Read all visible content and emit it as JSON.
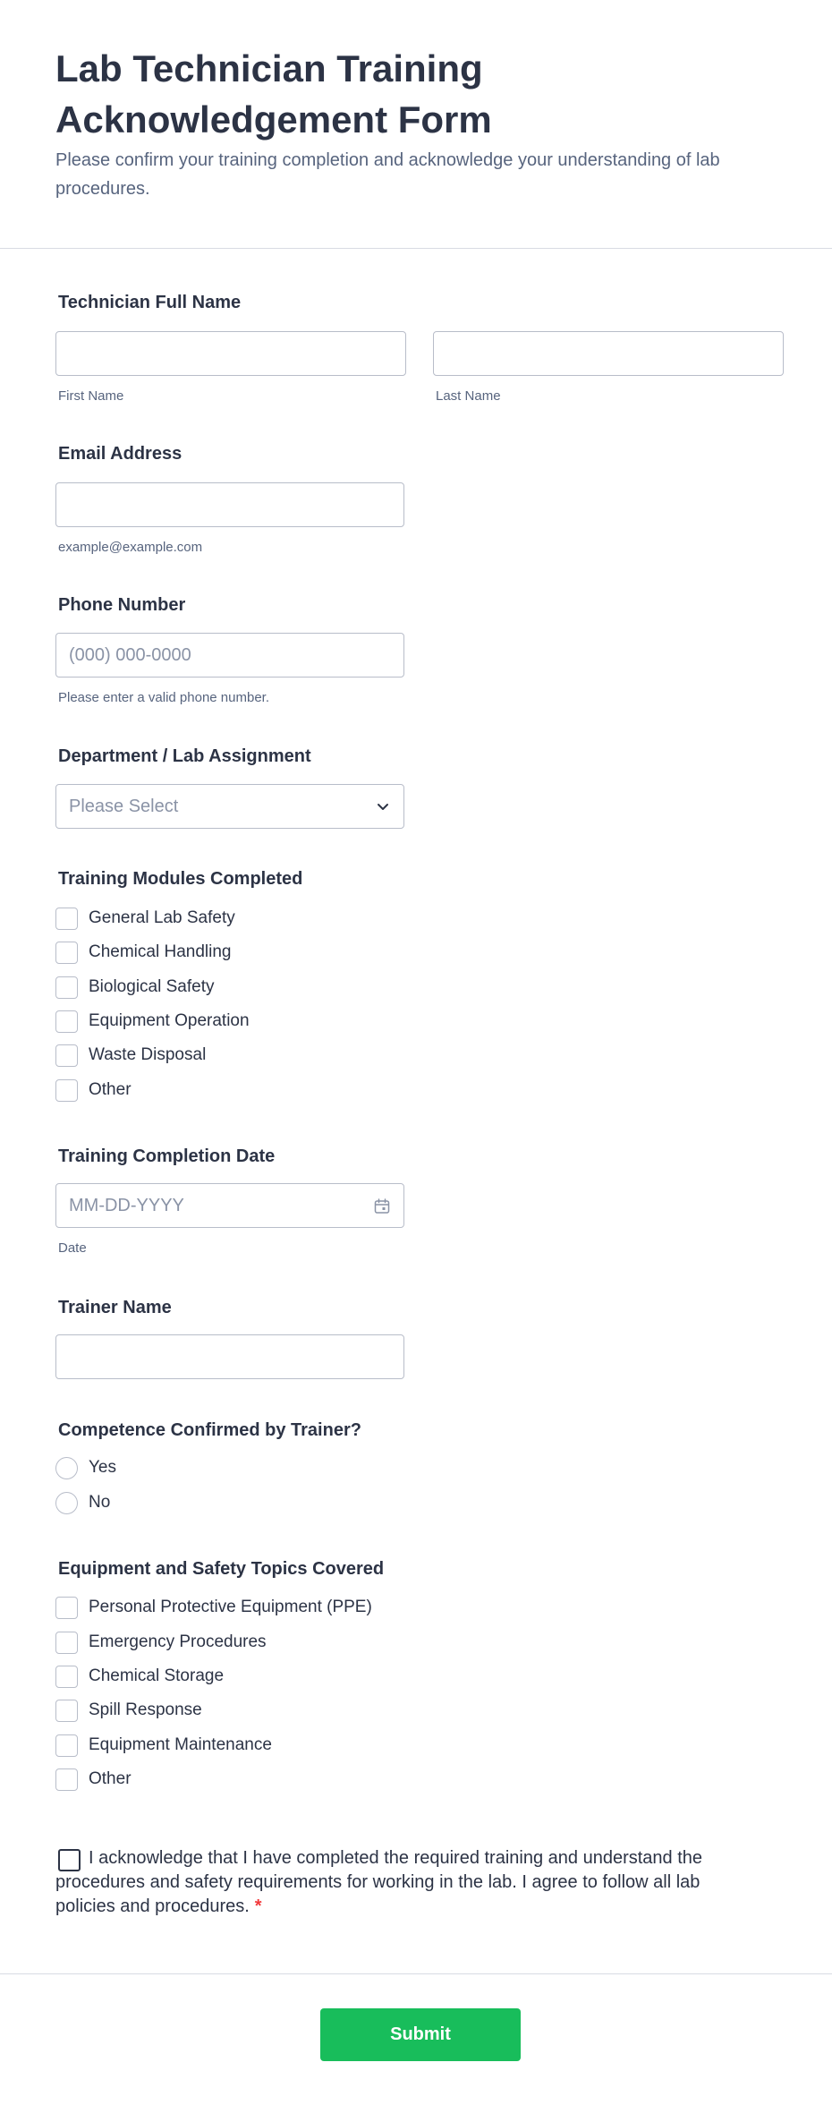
{
  "form": {
    "title": "Lab Technician Training Acknowledgement Form",
    "subtitle": "Please confirm your training completion and acknowledge your understanding of lab procedures."
  },
  "full_name": {
    "label": "Technician Full Name",
    "first_sublabel": "First Name",
    "last_sublabel": "Last Name"
  },
  "email": {
    "label": "Email Address",
    "sublabel": "example@example.com"
  },
  "phone": {
    "label": "Phone Number",
    "placeholder": "(000) 000-0000",
    "sublabel": "Please enter a valid phone number."
  },
  "department": {
    "label": "Department / Lab Assignment",
    "placeholder": "Please Select"
  },
  "modules": {
    "label": "Training Modules Completed",
    "options": [
      "General Lab Safety",
      "Chemical Handling",
      "Biological Safety",
      "Equipment Operation",
      "Waste Disposal",
      "Other"
    ]
  },
  "completion_date": {
    "label": "Training Completion Date",
    "placeholder": "MM-DD-YYYY",
    "sublabel": "Date"
  },
  "trainer": {
    "label": "Trainer Name"
  },
  "competence": {
    "label": "Competence Confirmed by Trainer?",
    "options": [
      "Yes",
      "No"
    ]
  },
  "topics": {
    "label": "Equipment and Safety Topics Covered",
    "options": [
      "Personal Protective Equipment (PPE)",
      "Emergency Procedures",
      "Chemical Storage",
      "Spill Response",
      "Equipment Maintenance",
      "Other"
    ]
  },
  "acknowledgement": {
    "text": "I acknowledge that I have completed the required training and understand the procedures and safety requirements for working in the lab. I agree to follow all lab policies and procedures.",
    "required_mark": "*"
  },
  "submit": {
    "label": "Submit"
  },
  "icons": {
    "select": "chevron-down-icon",
    "date": "calendar-icon"
  },
  "colors": {
    "accent": "#18bd5b",
    "required": "#f23a3c",
    "text": "#2c3345",
    "muted": "#57647e"
  }
}
